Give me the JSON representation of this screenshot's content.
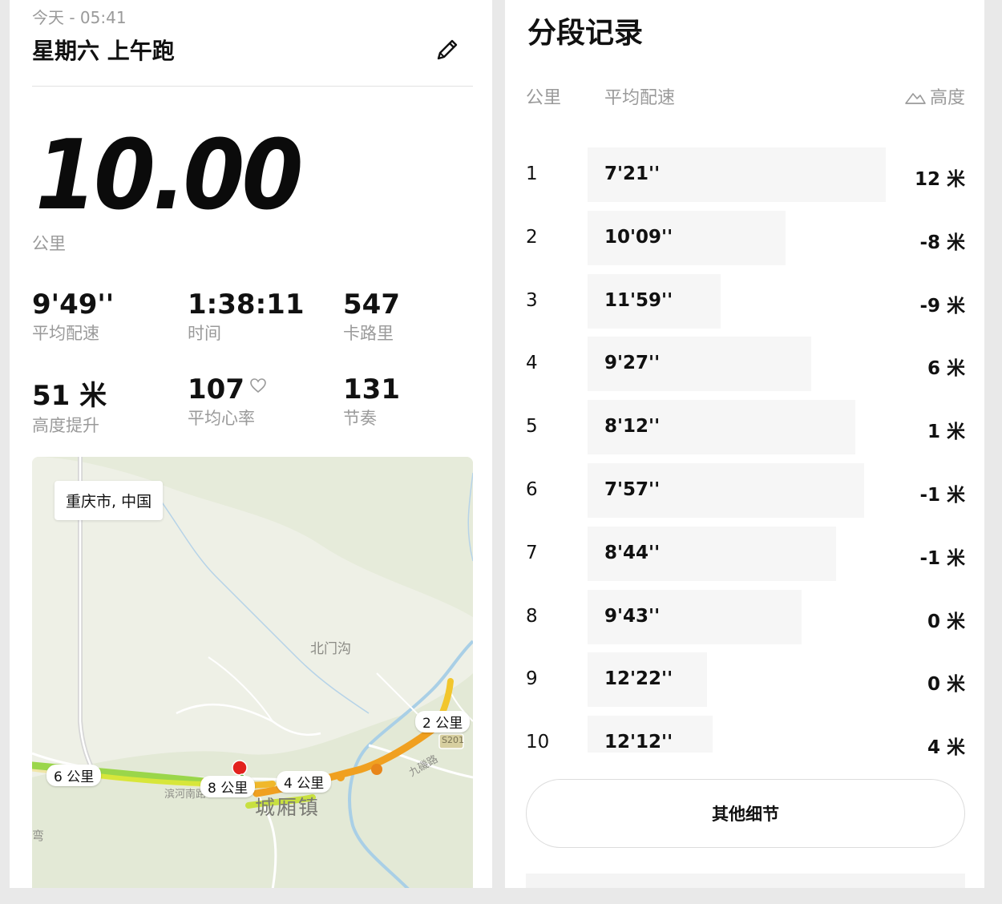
{
  "summary": {
    "date": "今天 - 05:41",
    "title": "星期六  上午跑",
    "distance": "10.00",
    "distance_unit": "公里",
    "stats": [
      {
        "value": "9'49''",
        "label": "平均配速"
      },
      {
        "value": "1:38:11",
        "label": "时间"
      },
      {
        "value": "547",
        "label": "卡路里"
      },
      {
        "value": "51 米",
        "label": "高度提升"
      },
      {
        "value": "107",
        "label": "平均心率"
      },
      {
        "value": "131",
        "label": "节奏"
      }
    ],
    "map": {
      "location": "重庆市, 中国",
      "markers": [
        "6 公里",
        "8 公里",
        "4 公里",
        "2 公里"
      ],
      "places": {
        "village": "北门沟",
        "town": "城厢镇",
        "road1": "滨河南路",
        "road2": "九磯路",
        "highway": "S201",
        "edge": "弯"
      }
    }
  },
  "splits": {
    "title": "分段记录",
    "col_km": "公里",
    "col_pace": "平均配速",
    "col_elev": "高度",
    "rows": [
      {
        "km": "1",
        "pace": "7'21''",
        "elev": "12 米",
        "pace_sec": 441
      },
      {
        "km": "2",
        "pace": "10'09''",
        "elev": "-8 米",
        "pace_sec": 609
      },
      {
        "km": "3",
        "pace": "11'59''",
        "elev": "-9 米",
        "pace_sec": 719
      },
      {
        "km": "4",
        "pace": "9'27''",
        "elev": "6 米",
        "pace_sec": 567
      },
      {
        "km": "5",
        "pace": "8'12''",
        "elev": "1 米",
        "pace_sec": 492
      },
      {
        "km": "6",
        "pace": "7'57''",
        "elev": "-1 米",
        "pace_sec": 477
      },
      {
        "km": "7",
        "pace": "8'44''",
        "elev": "-1 米",
        "pace_sec": 524
      },
      {
        "km": "8",
        "pace": "9'43''",
        "elev": "0 米",
        "pace_sec": 583
      },
      {
        "km": "9",
        "pace": "12'22''",
        "elev": "0 米",
        "pace_sec": 742
      },
      {
        "km": "10",
        "pace": "12'12''",
        "elev": "4 米",
        "pace_sec": 732
      }
    ],
    "more_button": "其他细节"
  }
}
